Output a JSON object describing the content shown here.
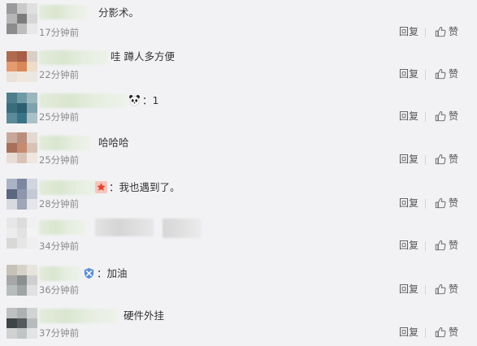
{
  "comments": [
    {
      "text": "分影术。",
      "time": "17分钟前"
    },
    {
      "text": "哇 蹲人多方便",
      "time": "22分钟前"
    },
    {
      "emoji": "panda-emoji",
      "text": "：1",
      "time": "25分钟前"
    },
    {
      "text": "哈哈哈",
      "time": "25分钟前"
    },
    {
      "emoji": "red-star-emoji",
      "text": "：我也遇到了。",
      "time": "28分钟前"
    },
    {
      "text": "",
      "time": "34分钟前"
    },
    {
      "emoji": "blue-badge-emoji",
      "text": "：加油",
      "time": "36分钟前"
    },
    {
      "text": "硬件外挂",
      "time": "37分钟前"
    }
  ],
  "actions": {
    "reply_label": "回复",
    "like_label": "赞"
  },
  "colors": {
    "background": "#f2f2f5",
    "text": "#333333",
    "meta": "#8a8a8a",
    "action": "#555555"
  }
}
